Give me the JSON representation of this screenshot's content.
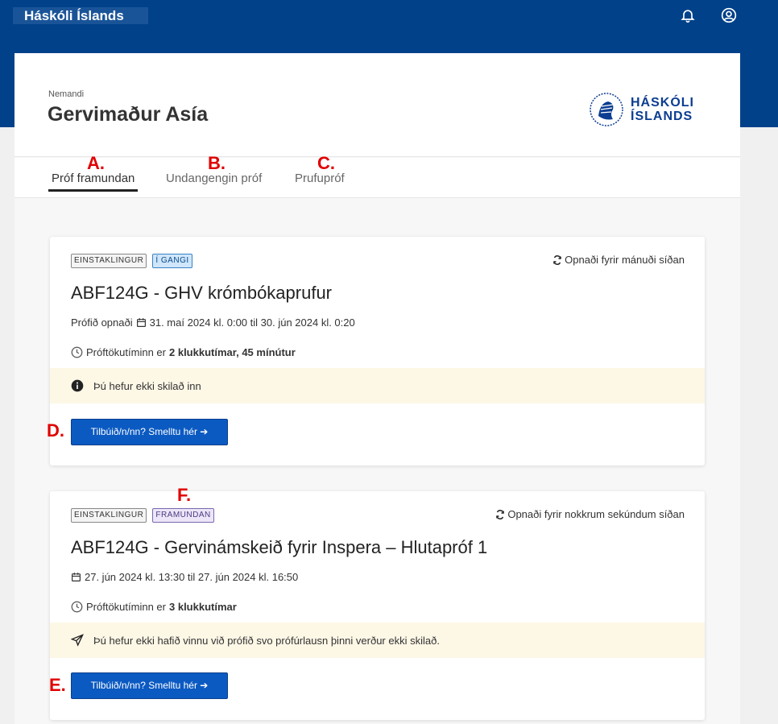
{
  "topbar": {
    "brand": "Háskóli Íslands",
    "bell_icon": "bell-icon",
    "user_icon": "user-circle-icon"
  },
  "header": {
    "role": "Nemandi",
    "name": "Gervimaður Asía",
    "logo_line1": "HÁSKÓLI",
    "logo_line2": "ÍSLANDS"
  },
  "tabs": [
    {
      "label": "Próf framundan",
      "marker": "A."
    },
    {
      "label": "Undangengin próf",
      "marker": "B."
    },
    {
      "label": "Prufupróf",
      "marker": "C."
    }
  ],
  "exams": [
    {
      "badge1": "EINSTAKLINGUR",
      "badge2": "Í GANGI",
      "opened": "Opnaði fyrir mánuði síðan",
      "title": "ABF124G - GHV krómbókaprufur",
      "opened_label": "Prófið opnaði",
      "dates": "31. maí 2024 kl. 0:00 til 30. jún 2024 kl. 0:20",
      "duration_prefix": "Próftökutíminn er",
      "duration_value": "2 klukkutímar, 45 mínútur",
      "notice": "Þú hefur ekki skilað inn",
      "button": "Tilbúið/n/nn? Smelltu hér",
      "marker_button": "D."
    },
    {
      "badge1": "EINSTAKLINGUR",
      "badge2": "FRAMUNDAN",
      "marker_badge": "F.",
      "opened": "Opnaði fyrir nokkrum sekúndum síðan",
      "title": "ABF124G - Gervinámskeið fyrir Inspera – Hlutapróf 1",
      "dates": "27. jún 2024 kl. 13:30 til 27. jún 2024 kl. 16:50",
      "duration_prefix": "Próftökutíminn er",
      "duration_value": "3 klukkutímar",
      "notice": "Þú hefur ekki hafið vinnu við prófið svo prófúrlausn þinni verður ekki skilað.",
      "button": "Tilbúið/n/nn? Smelltu hér",
      "marker_button": "E."
    }
  ],
  "colors": {
    "topbar": "#00418a",
    "button": "#0b5ac2",
    "notice_bg": "#fdf7e6",
    "marker": "#e00000"
  }
}
